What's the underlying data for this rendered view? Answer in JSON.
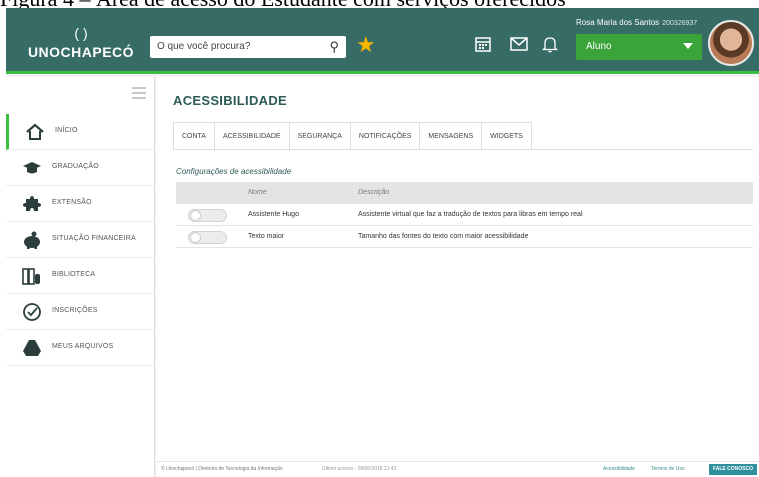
{
  "caption": "Figura 4 – Área de acesso do Estudante com serviços oferecidos",
  "header": {
    "logo_mark": "( )",
    "logo_name": "UNOCHAPECÓ",
    "search_placeholder": "O que você procura?",
    "user_name": "Rosa Maria dos Santos",
    "user_id": "200326937",
    "role": "Aluno"
  },
  "sidebar": {
    "items": [
      {
        "label": "INÍCIO",
        "icon": "home-icon",
        "active": true
      },
      {
        "label": "GRADUAÇÃO",
        "icon": "graduation-cap-icon"
      },
      {
        "label": "EXTENSÃO",
        "icon": "puzzle-icon"
      },
      {
        "label": "SITUAÇÃO FINANCEIRA",
        "icon": "piggy-bank-icon"
      },
      {
        "label": "BIBLIOTECA",
        "icon": "library-books-icon"
      },
      {
        "label": "INSCRIÇÕES",
        "icon": "check-circle-icon"
      },
      {
        "label": "MEUS ARQUIVOS",
        "icon": "drive-icon"
      }
    ]
  },
  "main": {
    "title": "ACESSIBILIDADE",
    "tabs": [
      {
        "label": "CONTA"
      },
      {
        "label": "ACESSIBILIDADE",
        "active": true
      },
      {
        "label": "SEGURANÇA"
      },
      {
        "label": "NOTIFICAÇÕES"
      },
      {
        "label": "MENSAGENS"
      },
      {
        "label": "WIDGETS"
      }
    ],
    "section_title": "Configurações de acessibilidade",
    "table": {
      "headers": {
        "name": "Nome",
        "description": "Descrição"
      },
      "rows": [
        {
          "name": "Assistente Hugo",
          "description": "Assistente virtual que faz a tradução de textos para libras em tempo real",
          "enabled": false
        },
        {
          "name": "Texto maior",
          "description": "Tamanho das fontes do texto com maior acessibilidade",
          "enabled": false
        }
      ]
    }
  },
  "footer": {
    "left": "© Unochapecó | Diretoria de Tecnologia da Informação",
    "last_access": "Último acesso : 08/06/2018 21:42",
    "link_accessibility": "Acessibilidade",
    "link_terms": "Termos de Uso",
    "contact_button": "FALE CONOSCO"
  },
  "colors": {
    "header_bg": "#376c66",
    "accent_green": "#3fbf3f",
    "star": "#f7b500",
    "title": "#2d5a56"
  }
}
